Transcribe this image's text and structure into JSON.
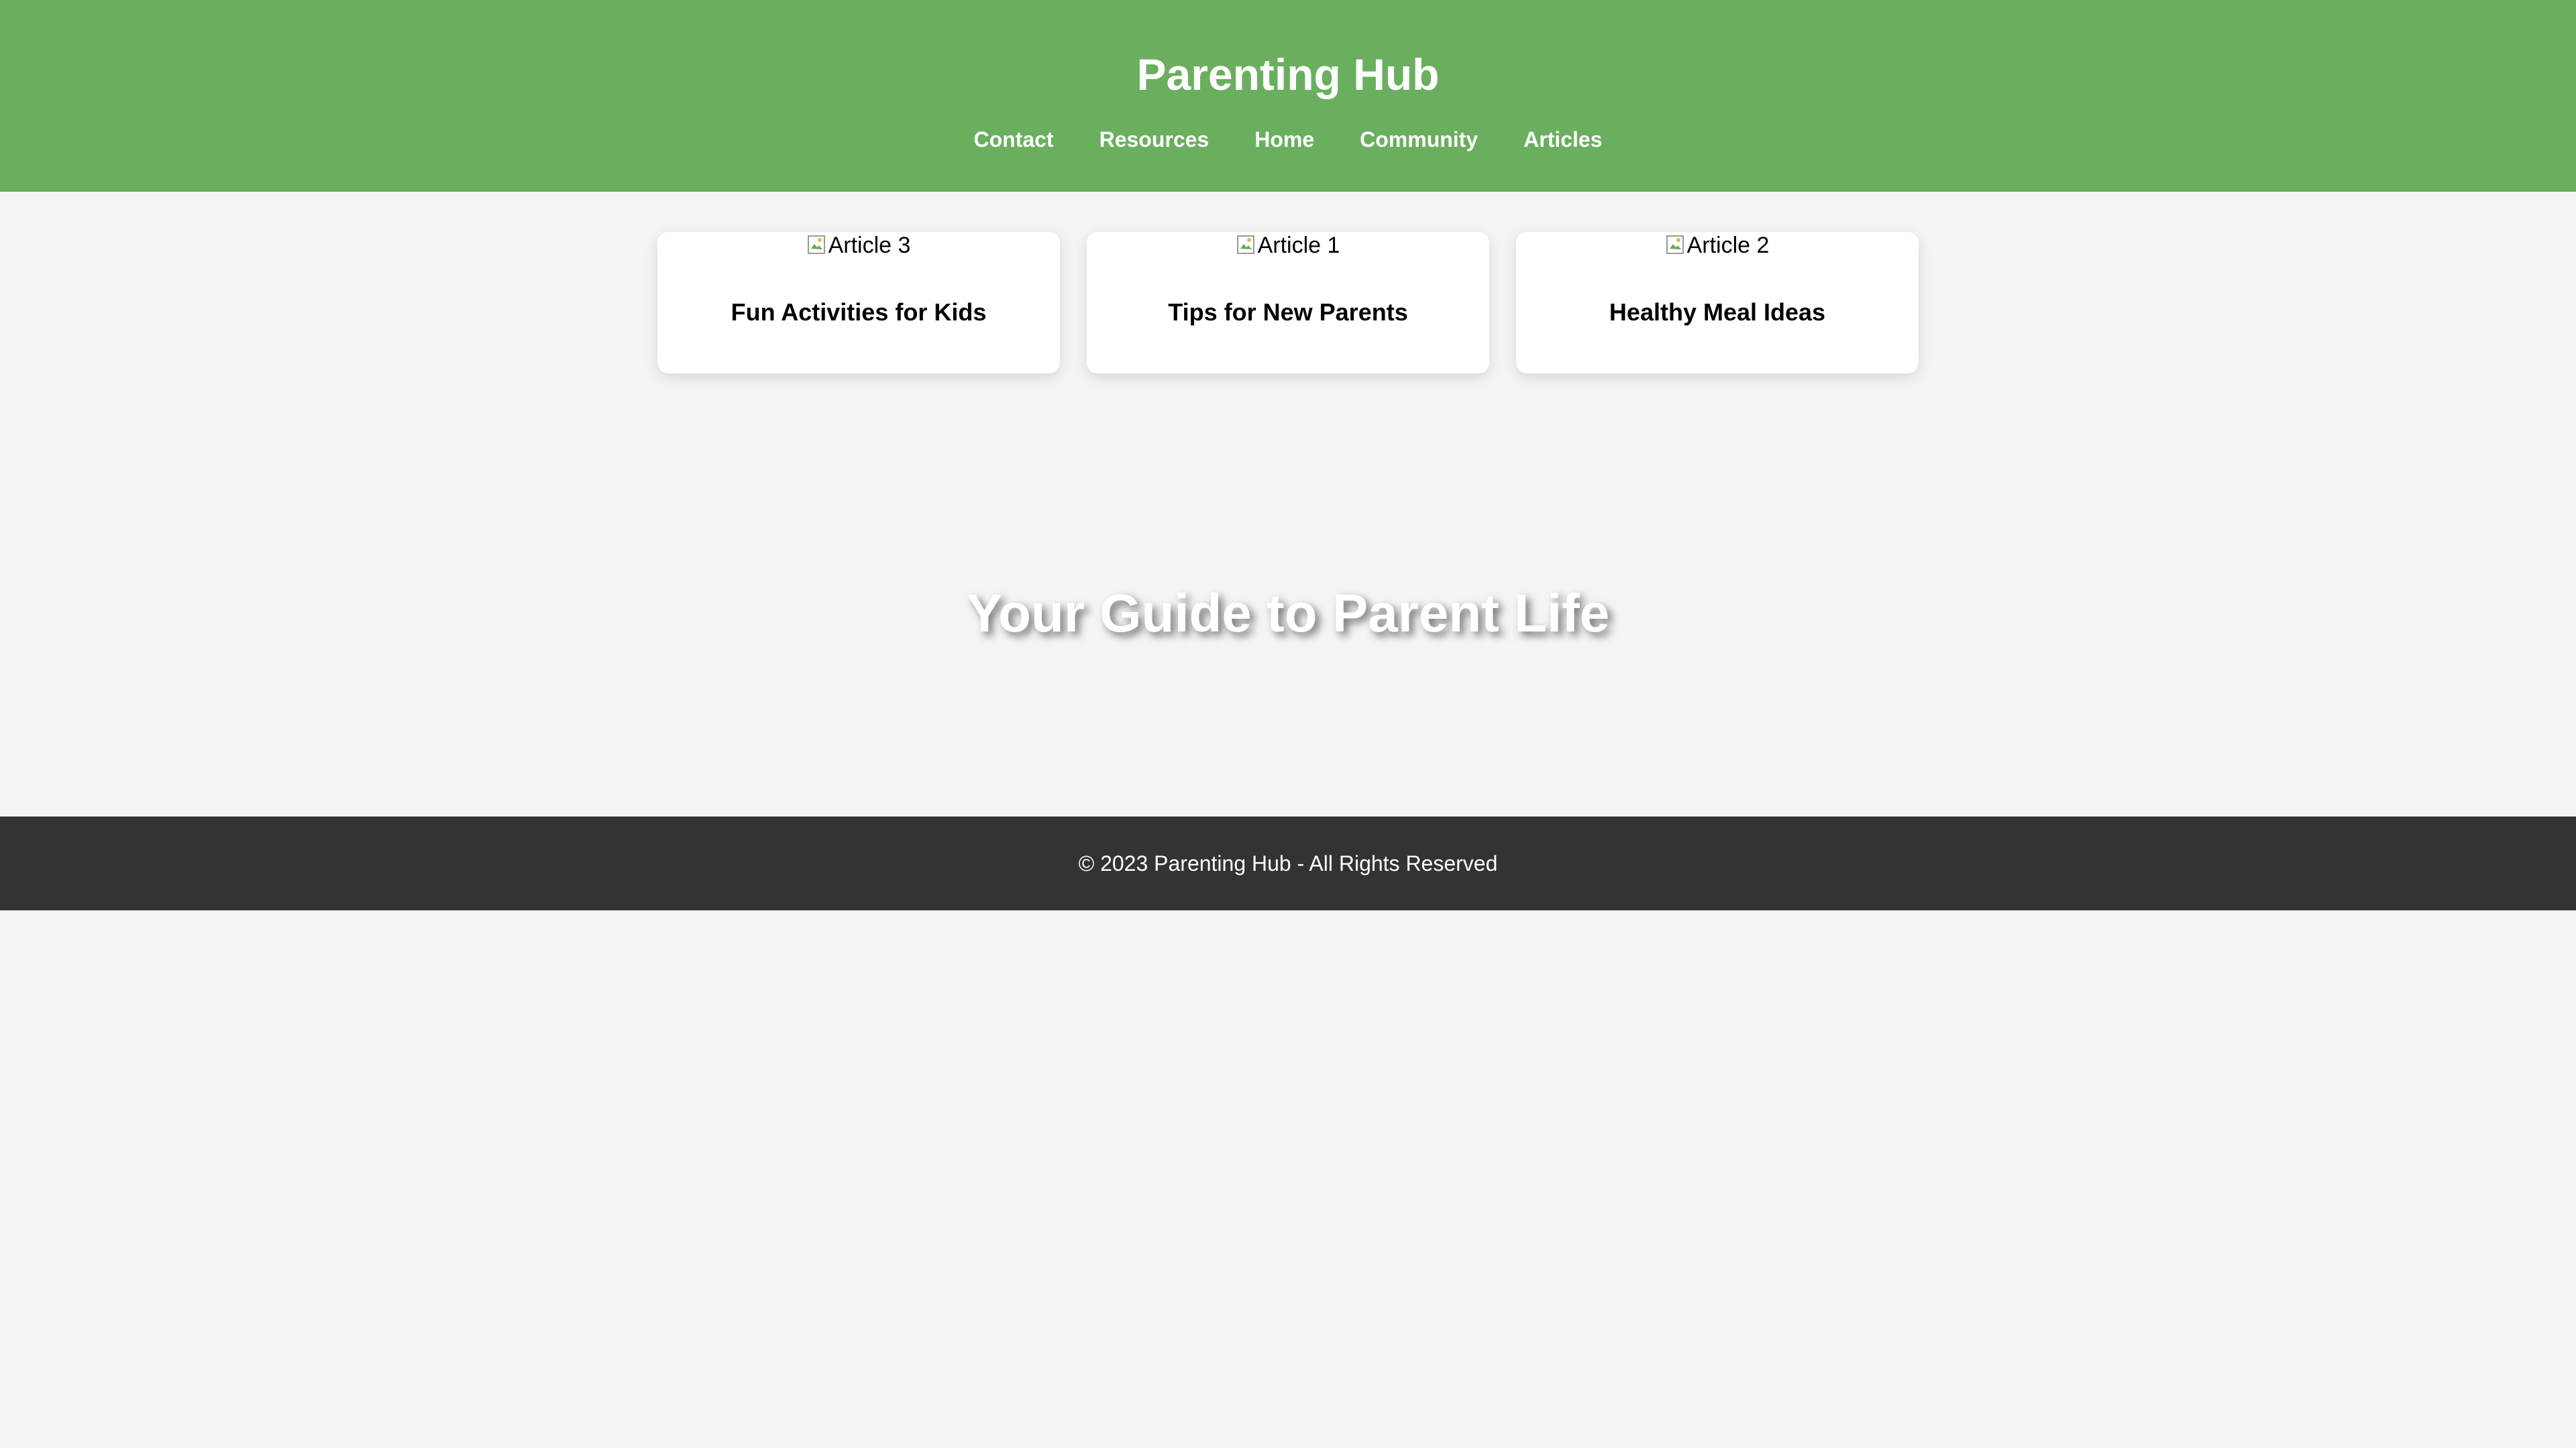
{
  "colors": {
    "header_bg": "#6aaf5e",
    "page_bg": "#f4f4f4",
    "footer_bg": "#333333",
    "header_text": "#ffffff"
  },
  "header": {
    "title": "Parenting Hub",
    "nav": [
      "Contact",
      "Resources",
      "Home",
      "Community",
      "Articles"
    ]
  },
  "articles": [
    {
      "image_alt": "Article 3",
      "image_icon": "broken-image-icon",
      "title": "Fun Activities for Kids"
    },
    {
      "image_alt": "Article 1",
      "image_icon": "broken-image-icon",
      "title": "Tips for New Parents"
    },
    {
      "image_alt": "Article 2",
      "image_icon": "broken-image-icon",
      "title": "Healthy Meal Ideas"
    }
  ],
  "hero": {
    "title": "Your Guide to Parent Life"
  },
  "footer": {
    "text": "© 2023 Parenting Hub - All Rights Reserved"
  }
}
